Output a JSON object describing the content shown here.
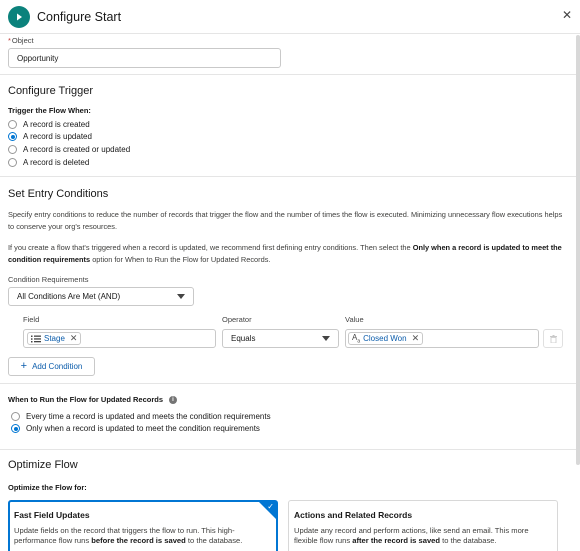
{
  "header": {
    "title": "Configure Start",
    "icon": "play-icon",
    "accent": "#0b827c"
  },
  "object": {
    "label": "Object",
    "value": "Opportunity"
  },
  "trigger": {
    "title": "Configure Trigger",
    "when_label": "Trigger the Flow When:",
    "options": [
      "A record is created",
      "A record is updated",
      "A record is created or updated",
      "A record is deleted"
    ],
    "selected": "A record is updated"
  },
  "entry": {
    "title": "Set Entry Conditions",
    "desc1": "Specify entry conditions to reduce the number of records that trigger the flow and the number of times the flow is executed. Minimizing unnecessary flow executions helps to conserve your org's resources.",
    "desc2_a": "If you create a flow that's triggered when a record is updated, we recommend first defining entry conditions. Then select the ",
    "desc2_bold": "Only when a record is updated to meet the condition requirements",
    "desc2_b": " option for When to Run the Flow for Updated Records.",
    "req_label": "Condition Requirements",
    "req_value": "All Conditions Are Met (AND)",
    "field_label": "Field",
    "operator_label": "Operator",
    "value_label": "Value",
    "field_value": "Stage",
    "operator_value": "Equals",
    "value_value": "Closed Won",
    "add_label": "Add Condition"
  },
  "when_run": {
    "title": "When to Run the Flow for Updated Records",
    "options": [
      "Every time a record is updated and meets the condition requirements",
      "Only when a record is updated to meet the condition requirements"
    ],
    "selected": "Only when a record is updated to meet the condition requirements"
  },
  "optimize": {
    "title": "Optimize Flow",
    "for_label": "Optimize the Flow for:",
    "card1_title": "Fast Field Updates",
    "card1_a": "Update fields on the record that triggers the flow to run. This high-performance flow runs ",
    "card1_bold": "before the record is saved",
    "card1_b": " to the database.",
    "card2_title": "Actions and Related Records",
    "card2_a": "Update any record and perform actions, like send an email. This more flexible flow runs ",
    "card2_bold": "after the record is saved",
    "card2_b": " to the database."
  },
  "colors": {
    "brand": "#0176d3",
    "link": "#0b5cab",
    "required": "#c23934"
  }
}
